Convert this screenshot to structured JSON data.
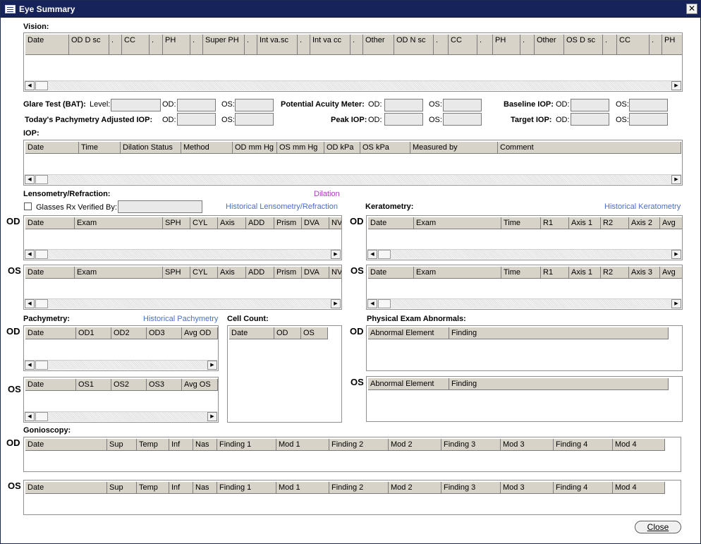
{
  "window": {
    "title": "Eye Summary",
    "close_glyph": "✕"
  },
  "vision": {
    "label": "Vision:",
    "columns": [
      "Date",
      "OD D sc",
      ".",
      "CC",
      ".",
      "PH",
      ".",
      "Super PH",
      ".",
      "Int va.sc",
      ".",
      "Int va cc",
      ".",
      "Other",
      "OD N sc",
      ".",
      "CC",
      ".",
      "PH",
      ".",
      "Other",
      "OS D sc",
      ".",
      "CC",
      ".",
      "PH"
    ]
  },
  "glare": {
    "label": "Glare Test (BAT):",
    "level_label": "Level:",
    "od_label": "OD:",
    "os_label": "OS:"
  },
  "pam": {
    "label": "Potential Acuity Meter:",
    "od_label": "OD:",
    "os_label": "OS:"
  },
  "baseline_iop": {
    "label": "Baseline IOP:",
    "od_label": "OD:",
    "os_label": "OS:"
  },
  "pachy_iop": {
    "label": "Today's Pachymetry Adjusted IOP:",
    "od_label": "OD:",
    "os_label": "OS:"
  },
  "peak_iop": {
    "label": "Peak IOP:",
    "od_label": "OD:",
    "os_label": "OS:"
  },
  "target_iop": {
    "label": "Target IOP:",
    "od_label": "OD:",
    "os_label": "OS:"
  },
  "iop": {
    "label": "IOP:",
    "columns": [
      "Date",
      "Time",
      "Dilation Status",
      "Method",
      "OD mm Hg",
      "OS mm Hg",
      "OD kPa",
      "OS kPa",
      "Measured by",
      "Comment"
    ]
  },
  "lensometry": {
    "label": "Lensometry/Refraction:",
    "dilation_link": "Dilation",
    "verified_label": "Glasses Rx Verified By:",
    "historical_link": "Historical Lensometry/Refraction",
    "columns": [
      "Date",
      "Exam",
      "SPH",
      "CYL",
      "Axis",
      "ADD",
      "Prism",
      "DVA",
      "NVA"
    ]
  },
  "keratometry": {
    "label": "Keratometry:",
    "historical_link": "Historical Keratometry",
    "od_columns": [
      "Date",
      "Exam",
      "Time",
      "R1",
      "Axis 1",
      "R2",
      "Axis 2",
      "Avg"
    ],
    "os_columns": [
      "Date",
      "Exam",
      "Time",
      "R1",
      "Axis 1",
      "R2",
      "Axis 3",
      "Avg"
    ]
  },
  "pachymetry": {
    "label": "Pachymetry:",
    "historical_link": "Historical Pachymetry",
    "od_columns": [
      "Date",
      "OD1",
      "OD2",
      "OD3",
      "Avg OD"
    ],
    "os_columns": [
      "Date",
      "OS1",
      "OS2",
      "OS3",
      "Avg OS"
    ]
  },
  "cell_count": {
    "label": "Cell Count:",
    "columns": [
      "Date",
      "OD",
      "OS"
    ]
  },
  "physical": {
    "label": "Physical Exam Abnormals:",
    "columns": [
      "Abnormal Element",
      "Finding"
    ]
  },
  "gonioscopy": {
    "label": "Gonioscopy:",
    "columns": [
      "Date",
      "Sup",
      "Temp",
      "Inf",
      "Nas",
      "Finding 1",
      "Mod 1",
      "Finding 2",
      "Mod 2",
      "Finding 3",
      "Mod 3",
      "Finding 4",
      "Mod 4"
    ]
  },
  "eyes": {
    "od": "OD",
    "os": "OS"
  },
  "scroll": {
    "left": "◀",
    "right": "▶"
  },
  "buttons": {
    "close": "Close"
  }
}
